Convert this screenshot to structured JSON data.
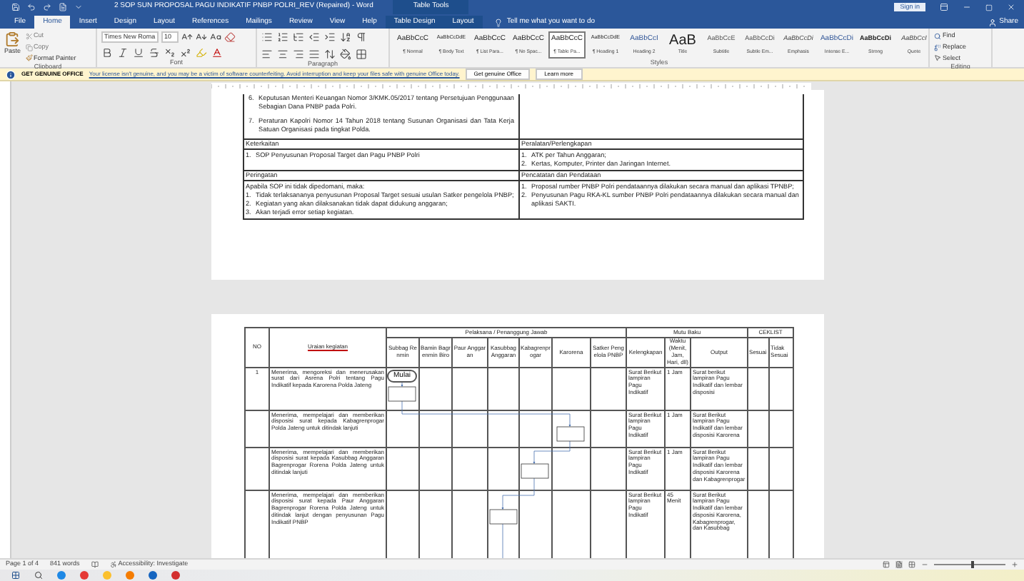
{
  "title_bar": {
    "title": "2 SOP SUN PROPOSAL PAGU INDIKATIF PNBP POLRI_REV (Repaired) - Word",
    "context_label": "Table Tools",
    "sign_in": "Sign in"
  },
  "tabs": [
    {
      "label": "File",
      "selected": false,
      "kind": "main"
    },
    {
      "label": "Home",
      "selected": true,
      "kind": "main"
    },
    {
      "label": "Insert",
      "selected": false,
      "kind": "main"
    },
    {
      "label": "Design",
      "selected": false,
      "kind": "main"
    },
    {
      "label": "Layout",
      "selected": false,
      "kind": "main"
    },
    {
      "label": "References",
      "selected": false,
      "kind": "main"
    },
    {
      "label": "Mailings",
      "selected": false,
      "kind": "main"
    },
    {
      "label": "Review",
      "selected": false,
      "kind": "main"
    },
    {
      "label": "View",
      "selected": false,
      "kind": "main"
    },
    {
      "label": "Help",
      "selected": false,
      "kind": "main"
    },
    {
      "label": "Table Design",
      "selected": false,
      "kind": "contextual"
    },
    {
      "label": "Layout",
      "selected": false,
      "kind": "contextual"
    }
  ],
  "tell_me": "Tell me what you want to do",
  "share": "Share",
  "ribbon": {
    "clipboard": {
      "paste": "Paste",
      "cut": "Cut",
      "copy": "Copy",
      "format_painter": "Format Painter",
      "label": "Clipboard"
    },
    "font": {
      "font_name": "Times New Roma",
      "font_size": "10",
      "label": "Font"
    },
    "paragraph": {
      "label": "Paragraph"
    },
    "styles": {
      "label": "Styles",
      "items": [
        {
          "preview": "AaBbCcC",
          "name": "¶ Normal",
          "kind": "plain",
          "selected": false
        },
        {
          "preview": "AaBbCcDdE",
          "name": "¶ Body Text",
          "kind": "small",
          "selected": false
        },
        {
          "preview": "AaBbCcC",
          "name": "¶ List Para...",
          "kind": "plain",
          "selected": false
        },
        {
          "preview": "AaBbCcC",
          "name": "¶ No Spac...",
          "kind": "plain",
          "selected": false
        },
        {
          "preview": "AaBbCcC",
          "name": "¶ Table Pa...",
          "kind": "plain",
          "selected": true
        },
        {
          "preview": "AaBbCcDdE",
          "name": "¶ Heading 1",
          "kind": "small",
          "selected": false
        },
        {
          "preview": "AaBbCcI",
          "name": "Heading 2",
          "kind": "heading",
          "selected": false
        },
        {
          "preview": "AaB",
          "name": "Title",
          "kind": "title",
          "selected": false
        },
        {
          "preview": "AaBbCcE",
          "name": "Subtitle",
          "kind": "subtle",
          "selected": false
        },
        {
          "preview": "AaBbCcDi",
          "name": "Subtle Em...",
          "kind": "subtle",
          "selected": false
        },
        {
          "preview": "AaBbCcDi",
          "name": "Emphasis",
          "kind": "italic",
          "selected": false
        },
        {
          "preview": "AaBbCcDi",
          "name": "Intense E...",
          "kind": "heading",
          "selected": false
        },
        {
          "preview": "AaBbCcDi",
          "name": "Strong",
          "kind": "bold",
          "selected": false
        },
        {
          "preview": "AaBbCcI",
          "name": "Quote",
          "kind": "italic",
          "selected": false
        }
      ]
    },
    "editing": {
      "find": "Find",
      "replace": "Replace",
      "select": "Select",
      "label": "Editing"
    }
  },
  "message_bar": {
    "title": "GET GENUINE OFFICE",
    "text": "Your license isn't genuine, and you may be a victim of software counterfeiting. Avoid interruption and keep your files safe with genuine Office today.",
    "buttons": [
      "Get genuine Office",
      "Learn more"
    ]
  },
  "page_1": {
    "items": [
      {
        "number": "6.",
        "text": "Keputusan Menteri Keuangan Nomor 3/KMK.05/2017 tentang Persetujuan Penggunaan Sebagian Dana PNBP pada Polri."
      },
      {
        "number": "7.",
        "text": "Peraturan Kapolri Nomor 14 Tahun 2018 tentang Susunan Organisasi dan Tata Kerja Satuan Organisasi pada tingkat Polda."
      }
    ],
    "sections": [
      {
        "left_title": "Keterkaitan",
        "right_title": "Peralatan/Perlengkapan",
        "left_list": [
          {
            "number": "1.",
            "text": "SOP Penyusunan Proposal Target dan Pagu PNBP Polri"
          }
        ],
        "right_list": [
          {
            "number": "1.",
            "text": "ATK per Tahun Anggaran;"
          },
          {
            "number": "2.",
            "text": "Kertas, Komputer, Printer dan Jaringan Internet."
          }
        ]
      },
      {
        "left_title": "Peringatan",
        "right_title": "Pencatatan dan Pendataan",
        "left_intro": "Apabila SOP ini tidak dipedomani, maka:",
        "left_list": [
          {
            "number": "1.",
            "text": "Tidak terlaksananya penyusunan Proposal Target sesuai usulan Satker pengelola PNBP;"
          },
          {
            "number": "2.",
            "text": "Kegiatan yang akan dilaksanakan tidak dapat didukung anggaran;"
          },
          {
            "number": "3.",
            "text": "Akan terjadi error setiap kegiatan."
          }
        ],
        "right_list": [
          {
            "number": "1.",
            "text": "Proposal rumber PNBP Polri pendataannya dilakukan secara manual dan aplikasi TPNBP;"
          },
          {
            "number": "2.",
            "text": "Penyusunan Pagu RKA-KL sumber PNBP Polri pendataannya dilakukan secara manual dan aplikasi SAKTI."
          }
        ]
      }
    ]
  },
  "page_2": {
    "table": {
      "no_header": "NO",
      "activity_header": "Uraian kegiatan",
      "executor_header": "Pelaksana / Penanggung Jawab",
      "standard_header": "Mutu Baku",
      "checklist_header": "CEKLIST",
      "executors": [
        "Subbag Renmin",
        "Bamin Bagrenmin Biro",
        "Paur Anggaran",
        "Kasubbag Anggaran",
        "Kabagrenprogar",
        "Karorena",
        "Satker Pengelola PNBP"
      ],
      "standards": [
        "Kelengkapan",
        "Waktu (Menit, Jam, Hari, dll)",
        "Output"
      ],
      "checks": [
        "Sesuai",
        "Tidak Sesuai"
      ],
      "rows": [
        {
          "no": "1",
          "activity": "Menerima, mengoreksi dan menerusakan surat dari Asrena Polri tentang Pagu Indikatif kepada Karorena Polda Jateng",
          "completeness": "Surat Berikut lampiran Pagu Indikatif",
          "time": "1 Jam",
          "output": "Surat berikut lampiran Pagu Indikatif dan lembar disposisi"
        },
        {
          "activity": "Menerima, mempelajari dan memberikan disposisi surat kepada Kabagrenprogar Polda Jateng untuk ditindak lanjuti",
          "completeness": "Surat Berikut lampiran Pagu Indikatif",
          "time": "1 Jam",
          "output": "Surat Berikut lampiran Pagu Indikatif dan lembar disposisi Karorena"
        },
        {
          "activity": "Menerima, mempelajari dan memberikan disposisi surat kepada Kasubbag Anggaran Bagrenprogar Rorena Polda Jateng untuk ditindak lanjuti",
          "completeness": "Surat Berikut lampiran Pagu Indikatif",
          "time": "1 Jam",
          "output": "Surat Berikut lampiran Pagu Indikatif dan lembar disposisi Karorena dan Kabagrenprogar"
        },
        {
          "activity": "Menerima, mempelajari dan memberikan disposisi surat kepada Paur Anggaran Bagrenprogar Rorena Polda Jateng untuk ditindak lanjut dengan penyusunan Pagu Indikatif PNBP",
          "completeness": "Surat Berikut lampiran Pagu Indikatif",
          "time": "45 Menit",
          "output": "Surat Berikut lampiran Pagu Indikatif dan lembar disposisi Karorena, Kabagrenprogar, dan Kasubbag"
        }
      ],
      "start_label": "Mulai"
    }
  },
  "status_bar": {
    "page": "Page 1 of 4",
    "words": "841 words",
    "accessibility": "Accessibility: Investigate",
    "zoom": {
      "level": 0.55
    }
  }
}
